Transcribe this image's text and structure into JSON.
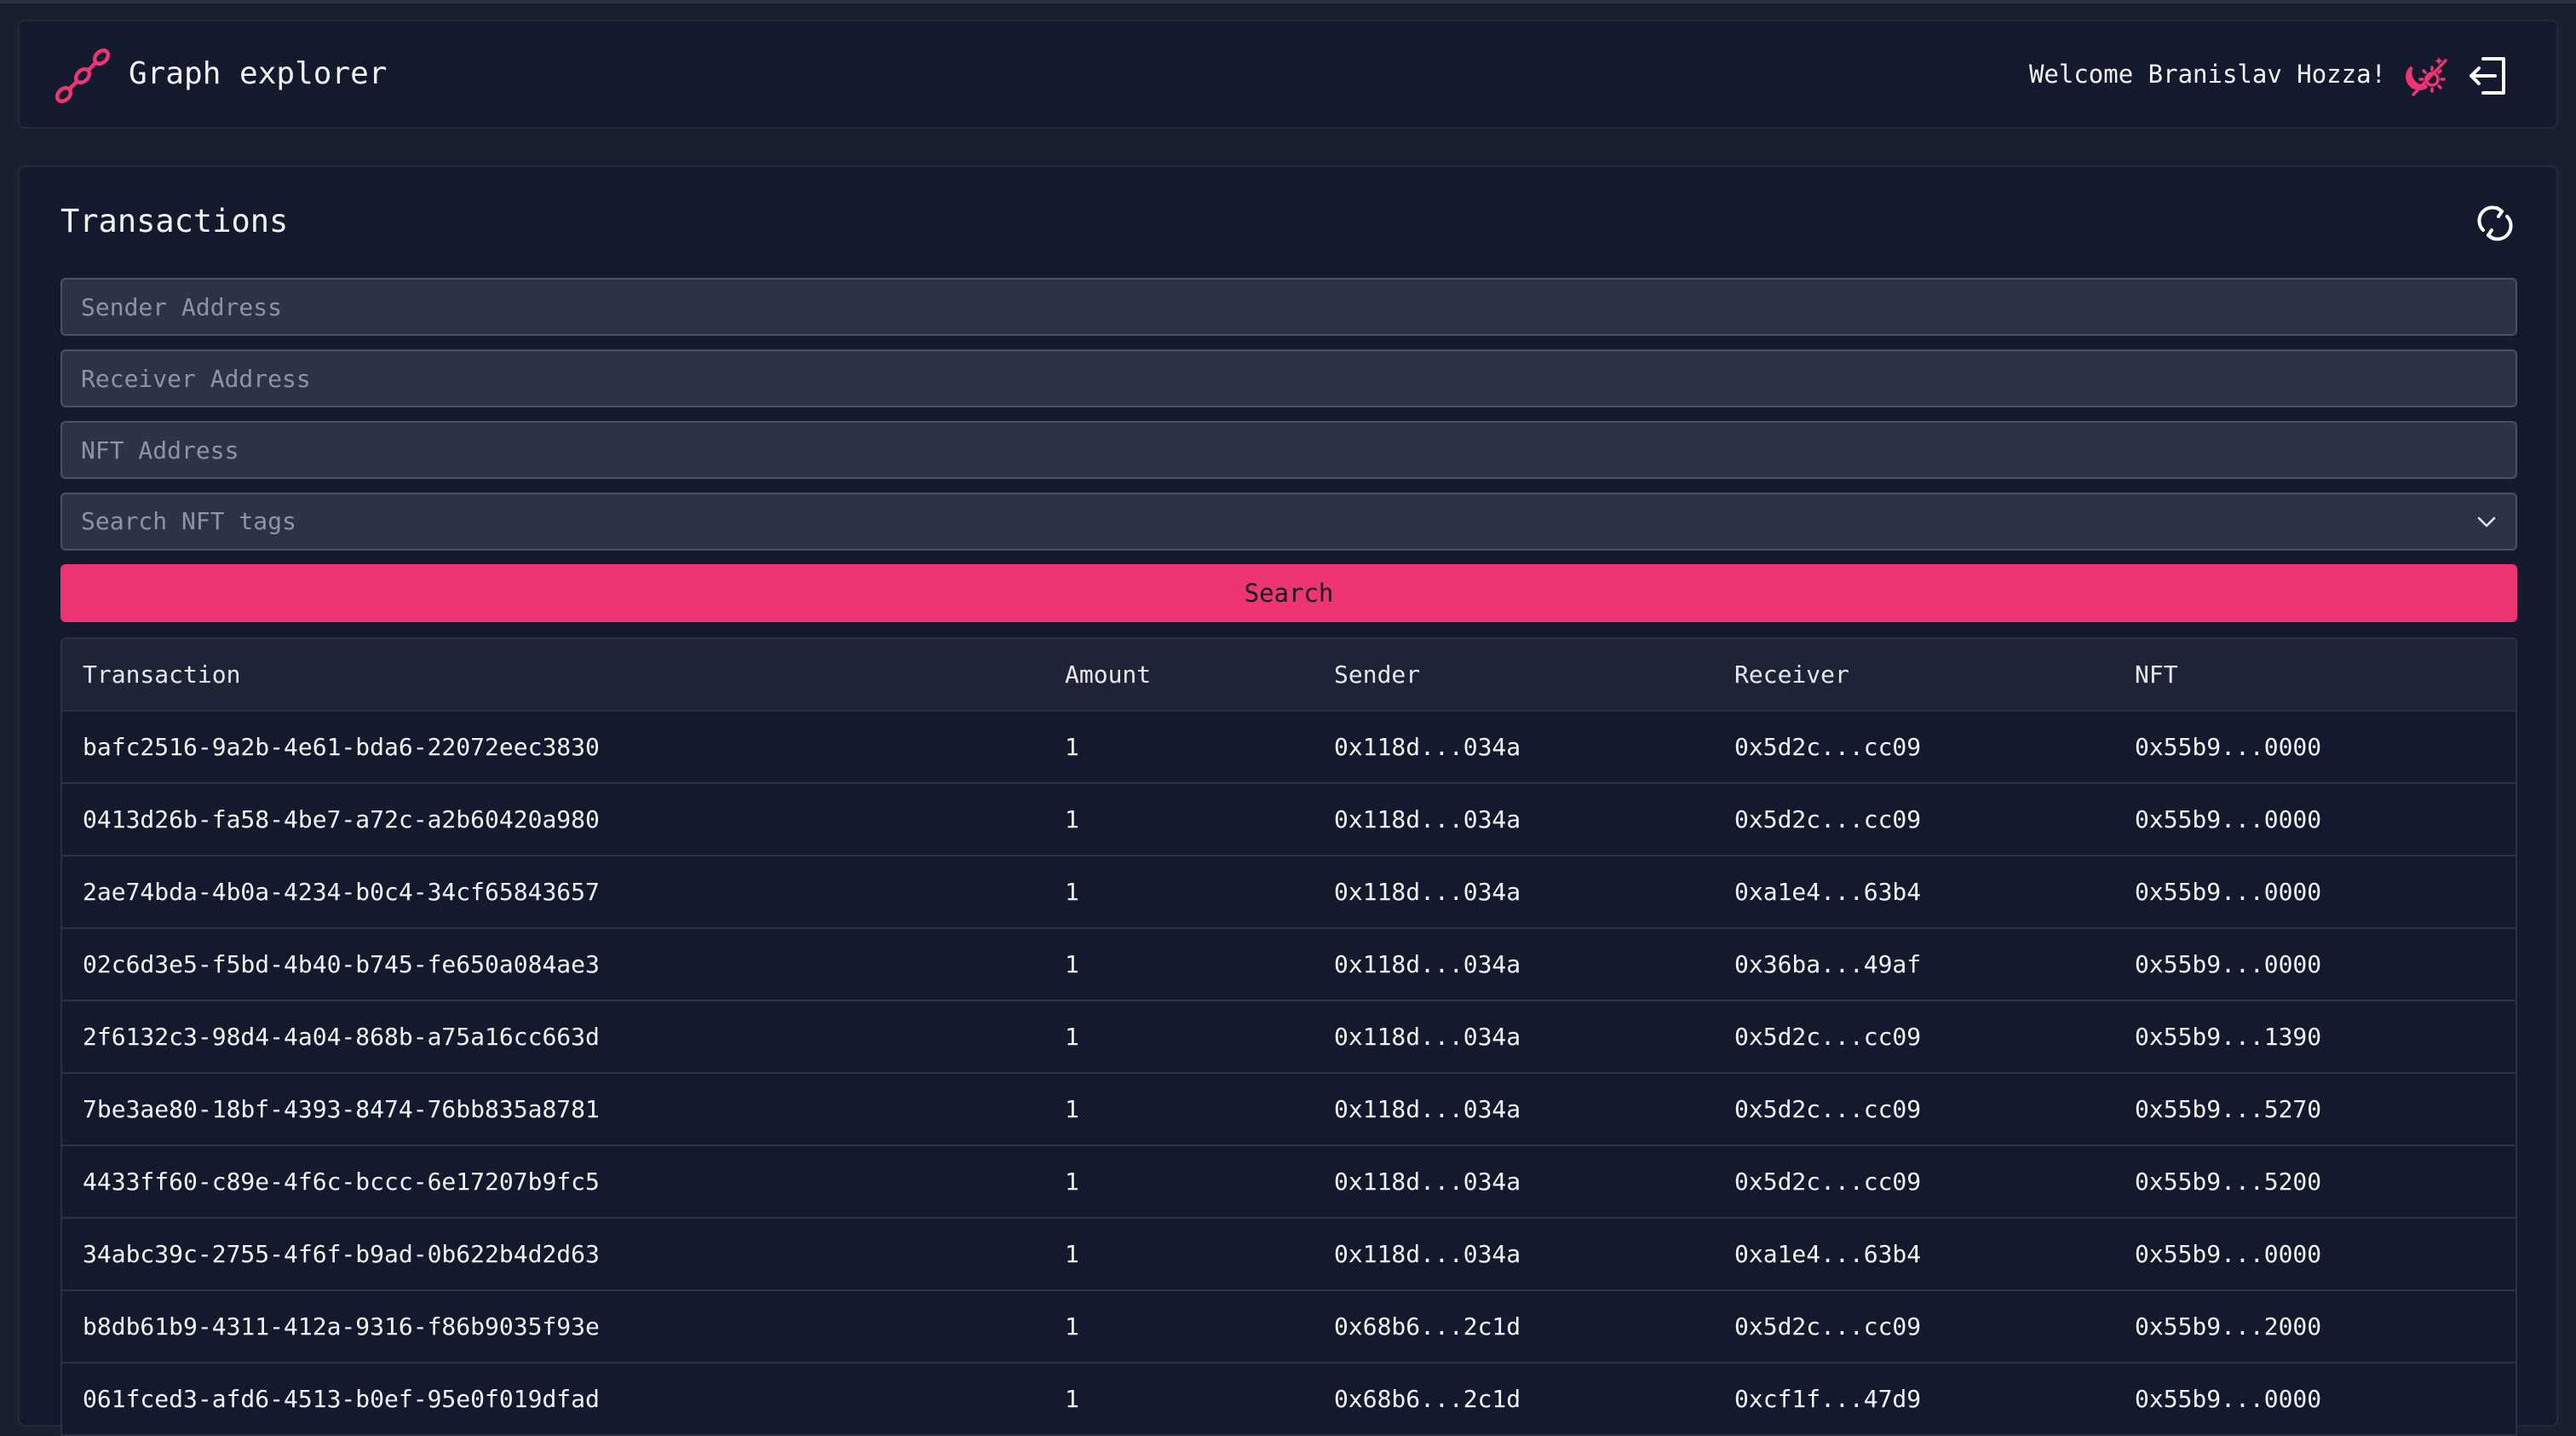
{
  "app": {
    "title": "Graph explorer",
    "welcome": "Welcome Branislav Hozza!",
    "accent_color": "#ec3571",
    "icons": {
      "logo": "chain-link-icon",
      "theme": "sun-moon-theme-icon",
      "logout": "logout-icon",
      "refresh": "refresh-icon",
      "dropdown": "chevron-down-icon"
    }
  },
  "panel": {
    "title": "Transactions",
    "sender_placeholder": "Sender Address",
    "receiver_placeholder": "Receiver Address",
    "nft_placeholder": "NFT Address",
    "tags_placeholder": "Search NFT tags",
    "search_label": "Search"
  },
  "table": {
    "columns": [
      "Transaction",
      "Amount",
      "Sender",
      "Receiver",
      "NFT"
    ],
    "rows": [
      [
        "bafc2516-9a2b-4e61-bda6-22072eec3830",
        "1",
        "0x118d...034a",
        "0x5d2c...cc09",
        "0x55b9...0000"
      ],
      [
        "0413d26b-fa58-4be7-a72c-a2b60420a980",
        "1",
        "0x118d...034a",
        "0x5d2c...cc09",
        "0x55b9...0000"
      ],
      [
        "2ae74bda-4b0a-4234-b0c4-34cf65843657",
        "1",
        "0x118d...034a",
        "0xa1e4...63b4",
        "0x55b9...0000"
      ],
      [
        "02c6d3e5-f5bd-4b40-b745-fe650a084ae3",
        "1",
        "0x118d...034a",
        "0x36ba...49af",
        "0x55b9...0000"
      ],
      [
        "2f6132c3-98d4-4a04-868b-a75a16cc663d",
        "1",
        "0x118d...034a",
        "0x5d2c...cc09",
        "0x55b9...1390"
      ],
      [
        "7be3ae80-18bf-4393-8474-76bb835a8781",
        "1",
        "0x118d...034a",
        "0x5d2c...cc09",
        "0x55b9...5270"
      ],
      [
        "4433ff60-c89e-4f6c-bccc-6e17207b9fc5",
        "1",
        "0x118d...034a",
        "0x5d2c...cc09",
        "0x55b9...5200"
      ],
      [
        "34abc39c-2755-4f6f-b9ad-0b622b4d2d63",
        "1",
        "0x118d...034a",
        "0xa1e4...63b4",
        "0x55b9...0000"
      ],
      [
        "b8db61b9-4311-412a-9316-f86b9035f93e",
        "1",
        "0x68b6...2c1d",
        "0x5d2c...cc09",
        "0x55b9...2000"
      ],
      [
        "061fced3-afd6-4513-b0ef-95e0f019dfad",
        "1",
        "0x68b6...2c1d",
        "0xcf1f...47d9",
        "0x55b9...0000"
      ]
    ]
  }
}
